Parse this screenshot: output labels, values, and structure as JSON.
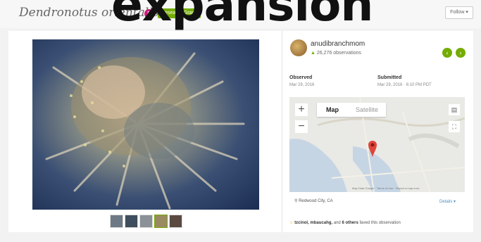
{
  "header": {
    "species": "Dendronotus orientalis",
    "count_badge": "5",
    "grade_badge": "Research Grade",
    "overlay_word": "expansion",
    "follow_label": "Follow ▾"
  },
  "photo": {
    "nav_prev": "◁",
    "nav_next": "▷",
    "thumbnails": 5
  },
  "observer": {
    "username": "anudibranchmom",
    "observations": "26,276 observations",
    "prev_arrow": "‹",
    "next_arrow": "›"
  },
  "meta": {
    "observed_label": "Observed",
    "observed_value": "Mar 29, 2016",
    "submitted_label": "Submitted",
    "submitted_value": "Mar 29, 2016 · 6:10 PM PDT"
  },
  "map": {
    "zoom_in": "+",
    "zoom_out": "−",
    "tab_map": "Map",
    "tab_satellite": "Satellite",
    "layers_icon": "layers-icon",
    "fullscreen_icon": "fullscreen-icon",
    "credit": "Map Data Google · Terms of Use · Report a map error",
    "place": "Redwood City, CA",
    "details_link": "Details ▾"
  },
  "faves": {
    "names": "tzcinol, mbaucahg,",
    "and_text": " and ",
    "others": "6 others",
    "suffix": " faved this observation"
  },
  "colors": {
    "accent_green": "#74ac00",
    "badge_pink": "#d2177a",
    "link_blue": "#4a90c2"
  }
}
